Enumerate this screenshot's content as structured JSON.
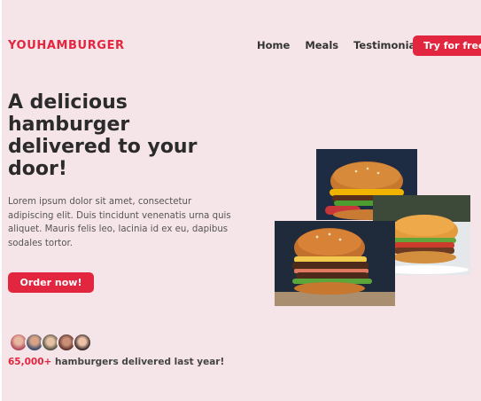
{
  "header": {
    "logo": "YOUHAMBURGER",
    "nav": [
      "Home",
      "Meals",
      "Testimonials"
    ],
    "cta": "Try for free"
  },
  "hero": {
    "title": "A delicious hamburger delivered to your door!",
    "description": "Lorem ipsum dolor sit amet, consectetur adipiscing elit. Duis tincidunt venenatis urna quis aliquet. Mauris felis leo, lacinia id ex eu, dapibus sodales tortor.",
    "order_button": "Order now!",
    "stat_number": "65,000+",
    "stat_text": "hamburgers delivered last year!"
  },
  "colors": {
    "accent": "#e3263f",
    "background": "#f6e5e8"
  }
}
